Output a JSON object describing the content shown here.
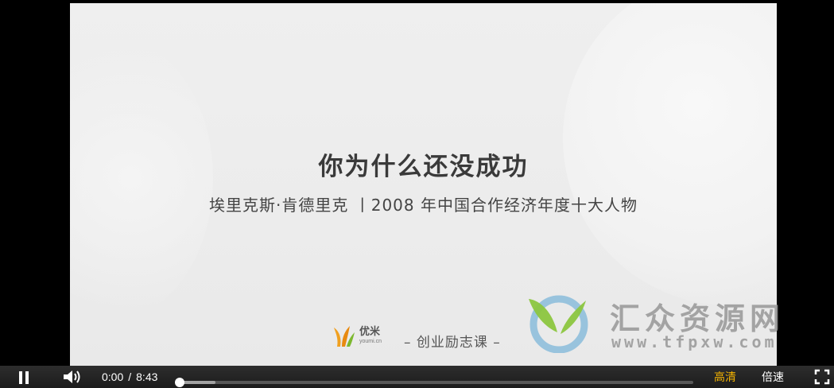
{
  "slide": {
    "title": "你为什么还没成功",
    "subtitle": "埃里克斯·肯德里克 丨2008 年中国合作经济年度十大人物",
    "logo_name": "优米",
    "logo_domain": "youmi.cn",
    "course_tag": "– 创业励志课 –"
  },
  "watermark": {
    "title": "汇众资源网",
    "url": "www.tfpxw.com"
  },
  "controls": {
    "current_time": "0:00",
    "separator": "/",
    "duration": "8:43",
    "progress": 0.0,
    "buffered": 0.07,
    "quality_label": "高清",
    "speed_label": "倍速",
    "quality_color": "#f5b400"
  },
  "icons": [
    "pause-icon",
    "volume-icon",
    "fullscreen-icon",
    "logo-icon",
    "watermark-logo-icon"
  ]
}
